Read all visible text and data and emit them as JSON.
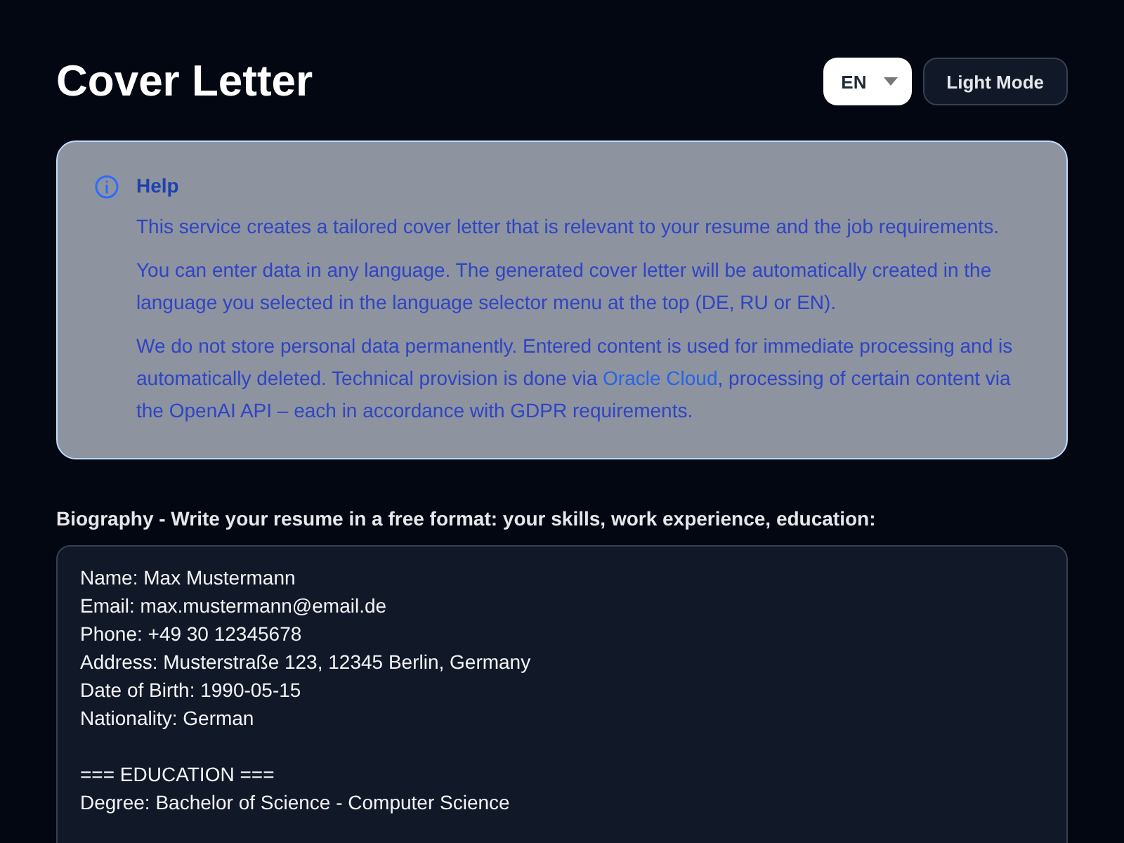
{
  "header": {
    "title": "Cover Letter",
    "language": {
      "value": "EN"
    },
    "theme_button": "Light Mode"
  },
  "help": {
    "title": "Help",
    "paragraphs": [
      {
        "text": "This service creates a tailored cover letter that is relevant to your resume and the job requirements."
      },
      {
        "text": "You can enter data in any language. The generated cover letter will be automatically created in the language you selected in the language selector menu at the top (DE, RU or EN)."
      },
      {
        "text": "We do not store personal data permanently. Entered content is used for immediate processing and is automatically deleted. Technical provision is done via ",
        "link": "Oracle Cloud",
        "after": ", processing of certain content via the OpenAI API – each in accordance with GDPR requirements."
      }
    ]
  },
  "biography": {
    "label": "Biography - Write your resume in a free format: your skills, work experience, education:",
    "value": "Name: Max Mustermann\nEmail: max.mustermann@email.de\nPhone: +49 30 12345678\nAddress: Musterstraße 123, 12345 Berlin, Germany\nDate of Birth: 1990-05-15\nNationality: German\n\n=== EDUCATION ===\nDegree: Bachelor of Science - Computer Science"
  }
}
